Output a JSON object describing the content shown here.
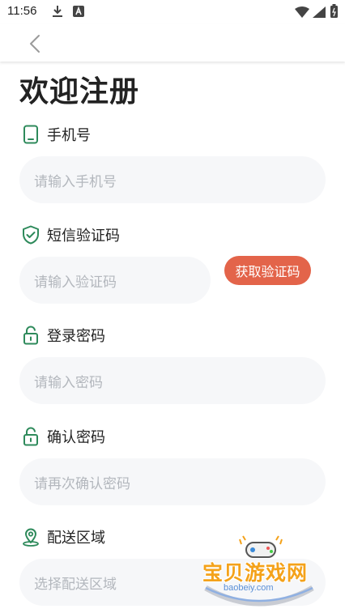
{
  "status_bar": {
    "time": "11:56"
  },
  "nav": {
    "back_icon": "chevron-left-icon"
  },
  "title": "欢迎注册",
  "fields": {
    "phone": {
      "label": "手机号",
      "placeholder": "请输入手机号",
      "icon": "phone-icon"
    },
    "sms": {
      "label": "短信验证码",
      "placeholder": "请输入验证码",
      "icon": "shield-check-icon",
      "button": "获取验证码"
    },
    "password": {
      "label": "登录密码",
      "placeholder": "请输入密码",
      "icon": "lock-icon"
    },
    "confirm": {
      "label": "确认密码",
      "placeholder": "请再次确认密码",
      "icon": "lock-icon"
    },
    "region": {
      "label": "配送区域",
      "placeholder": "选择配送区域",
      "icon": "location-pin-icon"
    }
  },
  "watermark": {
    "title": "宝贝游戏网",
    "url": "baobeiy.com"
  },
  "colors": {
    "accent": "#e3644a",
    "icon_green": "#2e8a5b",
    "input_bg": "#f6f7f9",
    "placeholder": "#b3b7bd"
  }
}
